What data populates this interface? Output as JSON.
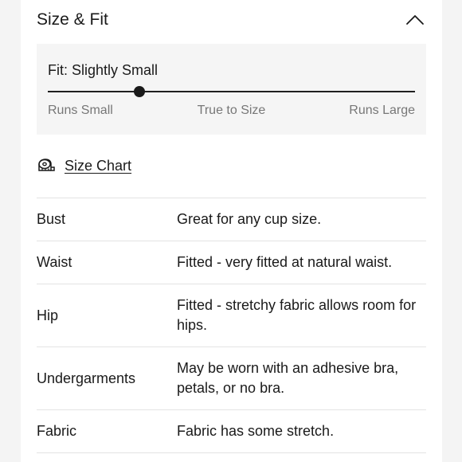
{
  "header": {
    "title": "Size & Fit",
    "collapse_icon": "chevron-up-icon"
  },
  "fit": {
    "label": "Fit: Slightly Small",
    "scale_left": "Runs Small",
    "scale_center": "True to Size",
    "scale_right": "Runs Large",
    "position_fraction": 0.25
  },
  "size_chart": {
    "icon": "measuring-tape-icon",
    "label": "Size Chart"
  },
  "details": [
    {
      "label": "Bust",
      "value": "Great for any cup size."
    },
    {
      "label": "Waist",
      "value": "Fitted - very fitted at natural waist."
    },
    {
      "label": "Hip",
      "value": "Fitted - stretchy fabric allows room for hips."
    },
    {
      "label": "Undergarments",
      "value": "May be worn with an adhesive bra, petals, or no bra."
    },
    {
      "label": "Fabric",
      "value": "Fabric has some stretch."
    }
  ]
}
